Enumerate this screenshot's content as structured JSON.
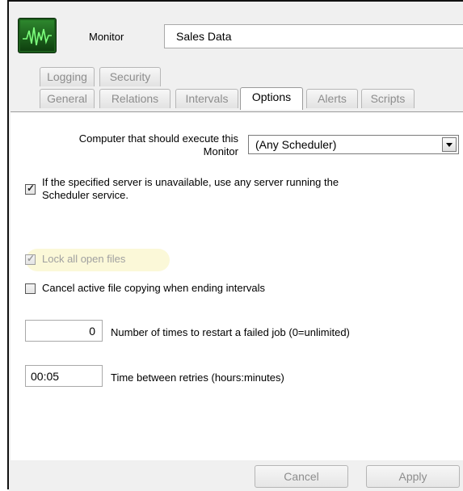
{
  "header": {
    "icon": "monitor-waveform-icon",
    "label": "Monitor",
    "name_value": "Sales Data"
  },
  "tabs": {
    "row1": [
      {
        "label": "Logging"
      },
      {
        "label": "Security"
      }
    ],
    "row2": [
      {
        "label": "General"
      },
      {
        "label": "Relations"
      },
      {
        "label": "Intervals"
      },
      {
        "label": "Options",
        "active": true
      },
      {
        "label": "Alerts"
      },
      {
        "label": "Scripts"
      }
    ]
  },
  "options": {
    "computer_label": "Computer that should execute this Monitor",
    "computer_label_line1": "Computer that should execute this",
    "computer_label_line2": "Monitor",
    "computer_selected": "(Any Scheduler)",
    "fallback_server": {
      "label_line1": "If the specified server is unavailable, use any server running the",
      "label_line2": "Scheduler service.",
      "checked": true
    },
    "lock_files": {
      "label": "Lock all open files",
      "checked": true,
      "enabled": false
    },
    "cancel_copy": {
      "label": "Cancel active file copying when ending intervals",
      "checked": false
    },
    "restart_count": {
      "value": "0",
      "label": "Number of times to restart a failed job (0=unlimited)"
    },
    "retry_time": {
      "value": "00:05",
      "label": "Time between retries (hours:minutes)"
    }
  },
  "buttons": {
    "cancel": "Cancel",
    "apply": "Apply"
  }
}
